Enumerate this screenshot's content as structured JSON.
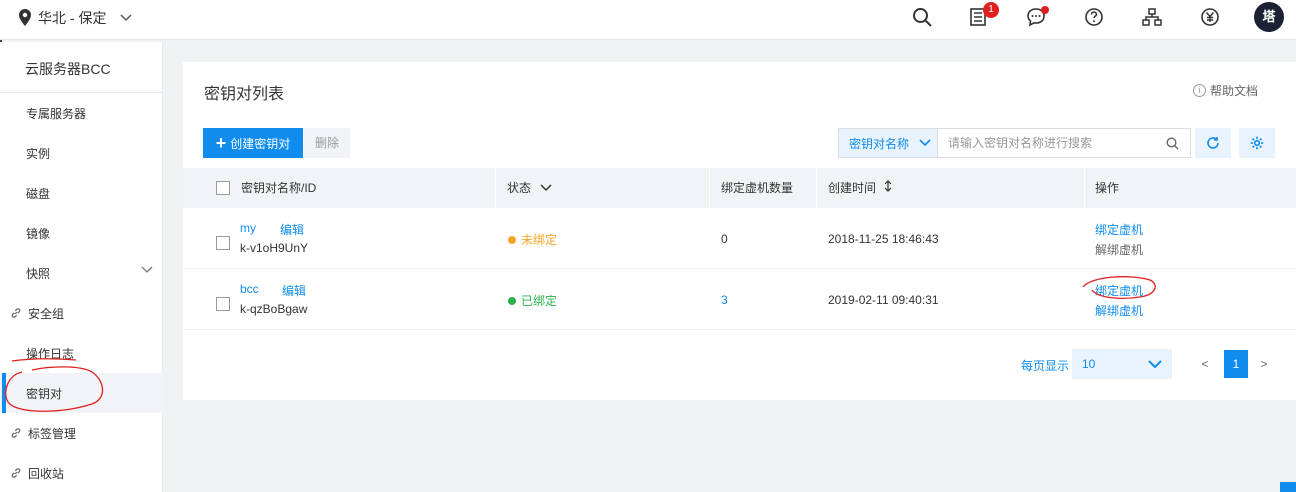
{
  "topbar": {
    "region": "华北 - 保定",
    "notification_count": "1",
    "avatar": "塔",
    "icons": [
      "search-icon",
      "orders-icon",
      "message-icon",
      "help-icon",
      "network-icon",
      "billing-icon"
    ]
  },
  "sidebar": {
    "title": "云服务器BCC",
    "items": [
      {
        "label": "专属服务器"
      },
      {
        "label": "实例"
      },
      {
        "label": "磁盘"
      },
      {
        "label": "镜像"
      },
      {
        "label": "快照"
      },
      {
        "label": "安全组"
      },
      {
        "label": "操作日志"
      },
      {
        "label": "密钥对"
      },
      {
        "label": "标签管理"
      },
      {
        "label": "回收站"
      }
    ]
  },
  "page": {
    "title": "密钥对列表",
    "help": "帮助文档",
    "create_button": "创建密钥对",
    "delete_button": "删除",
    "search_field": "密钥对名称",
    "search_placeholder": "请输入密钥对名称进行搜索"
  },
  "table": {
    "headers": [
      "密钥对名称/ID",
      "状态",
      "绑定虚机数量",
      "创建时间",
      "操作"
    ],
    "rows": [
      {
        "name": "my",
        "edit": "编辑",
        "id": "k-v1oH9UnY",
        "status": "未绑定",
        "count": "0",
        "created": "2018-11-25 18:46:43",
        "op1": "绑定虚机",
        "op2": "解绑虚机"
      },
      {
        "name": "bcc",
        "edit": "编辑",
        "id": "k-qzBoBgaw",
        "status": "已绑定",
        "count": "3",
        "created": "2019-02-11 09:40:31",
        "op1": "绑定虚机",
        "op2": "解绑虚机"
      }
    ]
  },
  "pagination": {
    "per_page_label": "每页显示",
    "per_page": "10",
    "prev": "<",
    "current": "1",
    "next": ">"
  },
  "colors": {
    "accent": "#108cee",
    "unbound": "#f5a623",
    "bound": "#2bb24c",
    "annotation": "#e02020"
  }
}
